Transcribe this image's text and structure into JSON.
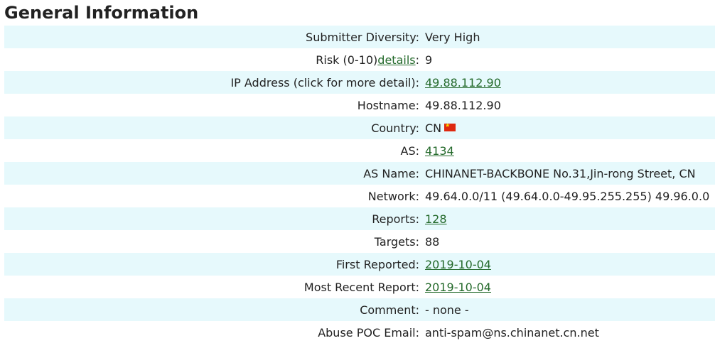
{
  "page": {
    "title": "General Information"
  },
  "rows": {
    "submitter_diversity": {
      "label": "Submitter Diversity:",
      "value": "Very High"
    },
    "risk": {
      "label_prefix": "Risk (0-10)",
      "label_link": "details",
      "label_suffix": ":",
      "value": "9"
    },
    "ip_address": {
      "label": "IP Address (click for more detail):",
      "value": "49.88.112.90"
    },
    "hostname": {
      "label": "Hostname:",
      "value": "49.88.112.90"
    },
    "country": {
      "label": "Country:",
      "value": "CN",
      "flag_icon": "china-flag-icon"
    },
    "as": {
      "label": "AS:",
      "value": "4134"
    },
    "as_name": {
      "label": "AS Name:",
      "value": "CHINANET-BACKBONE No.31,Jin-rong Street, CN"
    },
    "network": {
      "label": "Network:",
      "value": "49.64.0.0/11 (49.64.0.0-49.95.255.255) 49.96.0.0"
    },
    "reports": {
      "label": "Reports:",
      "value": "128"
    },
    "targets": {
      "label": "Targets:",
      "value": "88"
    },
    "first_reported": {
      "label": "First Reported:",
      "value": "2019-10-04"
    },
    "most_recent_report": {
      "label": "Most Recent Report:",
      "value": "2019-10-04"
    },
    "comment": {
      "label": "Comment:",
      "value": "- none -"
    },
    "abuse_poc_email": {
      "label": "Abuse POC Email:",
      "value": "anti-spam@ns.chinanet.cn.net"
    }
  },
  "colors": {
    "stripe": "#e6f9fc",
    "link": "#23692a",
    "text": "#222222"
  }
}
